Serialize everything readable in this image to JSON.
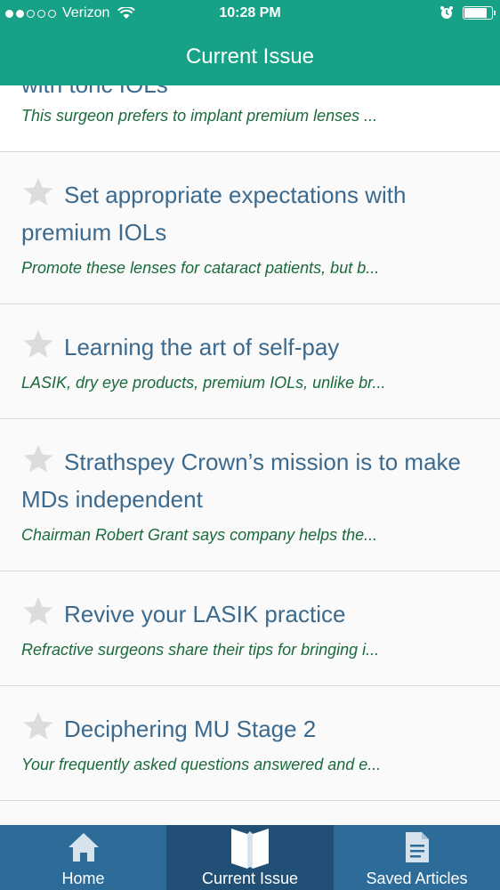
{
  "status": {
    "carrier": "Verizon",
    "time": "10:28 PM"
  },
  "nav": {
    "title": "Current Issue"
  },
  "articles": [
    {
      "title_partial": "with toric IOLs",
      "description": "This surgeon prefers to implant premium lenses ..."
    },
    {
      "title": "Set appropriate expectations with premium IOLs",
      "description": "Promote these lenses for cataract patients, but b..."
    },
    {
      "title": "Learning the art of self-pay",
      "description": "LASIK, dry eye products, premium IOLs, unlike br..."
    },
    {
      "title": "Strathspey Crown’s mission is to make MDs independent",
      "description": "Chairman Robert Grant says company helps the..."
    },
    {
      "title": "Revive your LASIK practice",
      "description": "Refractive surgeons share their tips for bringing i..."
    },
    {
      "title": "Deciphering MU Stage 2",
      "description": "Your frequently asked questions answered and e..."
    }
  ],
  "tabs": {
    "home": "Home",
    "current": "Current Issue",
    "saved": "Saved Articles"
  },
  "colors": {
    "header": "#17a287",
    "tabbar": "#2d6c99",
    "title": "#3c6a8e",
    "description": "#1a6a3c"
  },
  "icons": {
    "star": "star-icon",
    "home": "home-icon",
    "book": "book-icon",
    "document": "document-icon"
  }
}
